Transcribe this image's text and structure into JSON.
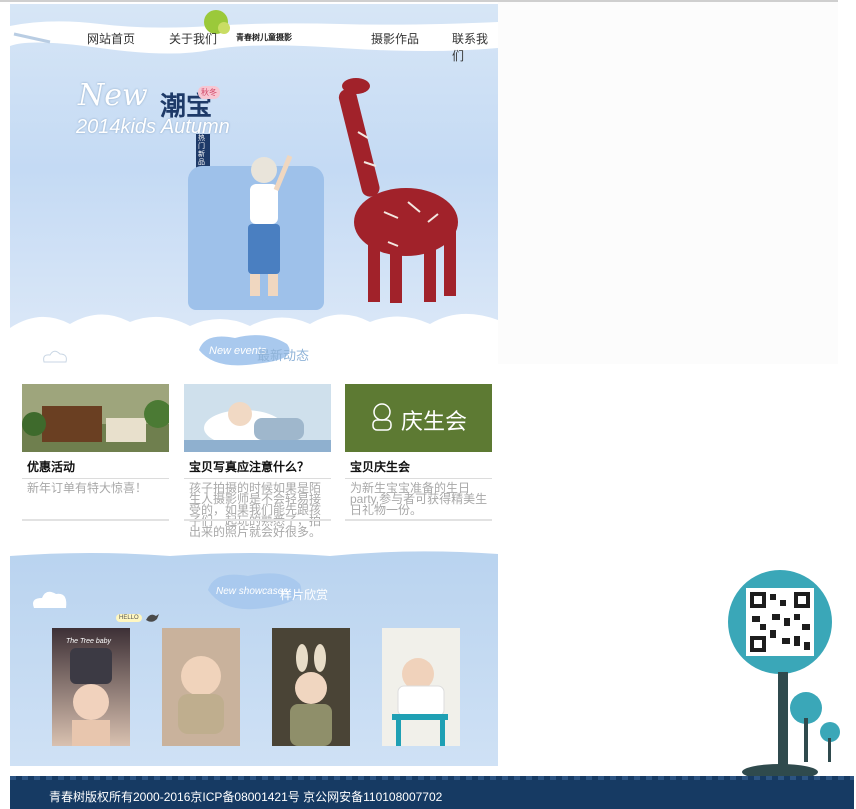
{
  "nav": {
    "home": "网站首页",
    "about": "关于我们",
    "works": "摄影作品",
    "contact": "联系我们"
  },
  "brand": {
    "name": "青春树儿童摄影"
  },
  "banner": {
    "line1": "New",
    "line2": "2014kids Autumn",
    "chao": "潮宝",
    "tag": "秋冬",
    "tag2": "热门新品"
  },
  "events": {
    "badge": "New events",
    "title": "最新动态"
  },
  "cards": [
    {
      "title": "优惠活动",
      "desc": "新年订单有特大惊喜！"
    },
    {
      "title": "宝贝写真应注意什么？",
      "desc": "孩子拍摄的时候如果是陌生人摄影师是不会轻易接受的，如果我们能先跟孩子们一起玩的熟悉了，拍出来的照片就会好很多。"
    },
    {
      "title": "宝贝庆生会",
      "img_text": "庆生会",
      "desc": "为新生宝宝准备的生日party,参与者可获得精美生日礼物一份。"
    }
  ],
  "showcase": {
    "badge": "New showcases",
    "title": "样片欣赏",
    "hello": "HELLO",
    "photo_caption": "The Tree baby"
  },
  "footer": {
    "copyright": "青春树版权所有2000-2016京ICP备08001421号  京公网安备110108007702"
  },
  "colors": {
    "footer_bg": "#163a63",
    "sky": "#c4daf4",
    "card3_bg": "#5d7a33",
    "qr_teal": "#3aa7b8"
  }
}
